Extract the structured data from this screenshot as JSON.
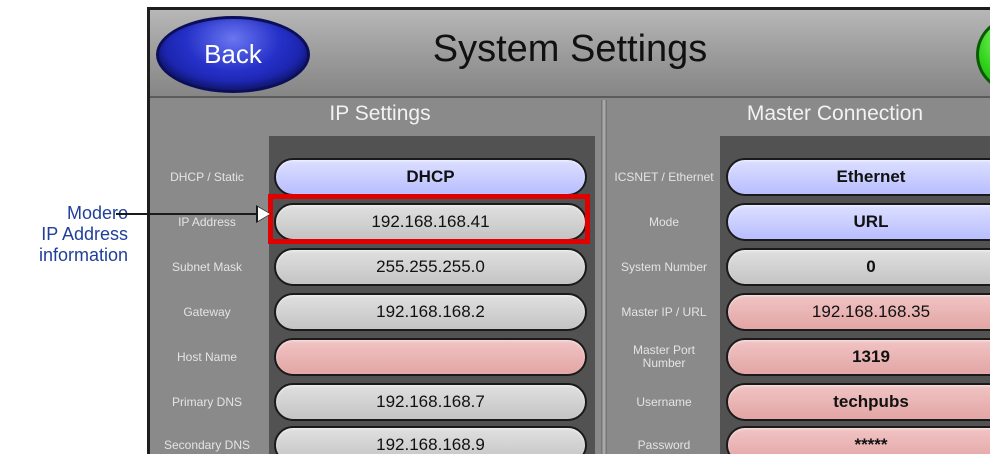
{
  "annotation": {
    "line1": "Modero",
    "line2": "IP Address",
    "line3": "information"
  },
  "header": {
    "back_label": "Back",
    "title": "System Settings"
  },
  "ip_settings": {
    "title": "IP Settings",
    "rows": [
      {
        "label": "DHCP / Static",
        "value": "DHCP",
        "style": "blue"
      },
      {
        "label": "IP Address",
        "value": "192.168.168.41",
        "style": "gray"
      },
      {
        "label": "Subnet Mask",
        "value": "255.255.255.0",
        "style": "gray"
      },
      {
        "label": "Gateway",
        "value": "192.168.168.2",
        "style": "gray"
      },
      {
        "label": "Host Name",
        "value": "",
        "style": "pink"
      },
      {
        "label": "Primary DNS",
        "value": "192.168.168.7",
        "style": "gray"
      },
      {
        "label": "Secondary DNS",
        "value": "192.168.168.9",
        "style": "gray"
      }
    ]
  },
  "master_connection": {
    "title": "Master Connection",
    "rows": [
      {
        "label": "ICSNET / Ethernet",
        "value": "Ethernet",
        "style": "blue"
      },
      {
        "label": "Mode",
        "value": "URL",
        "style": "blue"
      },
      {
        "label": "System Number",
        "value": "0",
        "style": "gray"
      },
      {
        "label": "Master IP / URL",
        "value": "192.168.168.35",
        "style": "pink"
      },
      {
        "label": "Master Port Number",
        "value": "1319",
        "style": "pink"
      },
      {
        "label": "Username",
        "value": "techpubs",
        "style": "pink"
      },
      {
        "label": "Password",
        "value": "*****",
        "style": "pink"
      }
    ]
  }
}
